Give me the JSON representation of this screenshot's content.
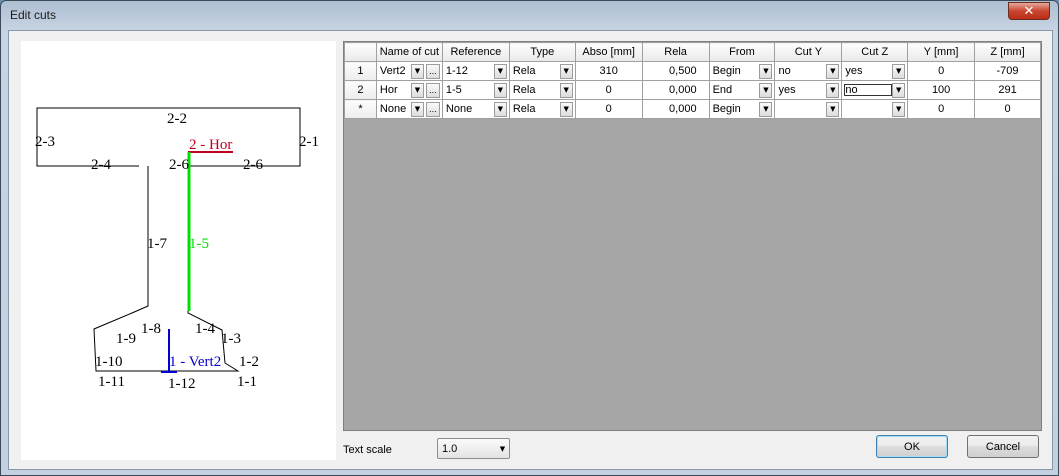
{
  "window": {
    "title": "Edit cuts",
    "close_glyph": "✕"
  },
  "drawing": {
    "labels": {
      "top_2_2": "2-2",
      "left_2_3": "2-3",
      "right_2_1": "2-1",
      "left_2_4": "2-4",
      "mid_2_6a": "2-6",
      "right_2_6": "2-6",
      "cut_hor": "2 - Hor",
      "web_1_7": "1-7",
      "web_1_5": "1-5",
      "b_1_8": "1-8",
      "b_1_9": "1-9",
      "b_1_4": "1-4",
      "b_1_3": "1-3",
      "b_1_10": "1-10",
      "b_1_2": "1-2",
      "cut_vert": "1 - Vert2",
      "b_1_11": "1-11",
      "b_1_12": "1-12",
      "b_1_1": "1-1"
    },
    "colors": {
      "outline": "#000000",
      "hor_cut": "#c00020",
      "web_highlight": "#00e000",
      "vert_cut": "#0000d0"
    }
  },
  "grid": {
    "columns": [
      "",
      "Name of cut",
      "Reference",
      "Type",
      "Abso [mm]",
      "Rela",
      "From",
      "Cut Y",
      "Cut Z",
      "Y  [mm]",
      "Z  [mm]"
    ],
    "rows": [
      {
        "id": "1",
        "name": "Vert2",
        "reference": "1-12",
        "type": "Rela",
        "abso": "310",
        "rela": "0,500",
        "from": "Begin",
        "cut_y": "no",
        "cut_z": "yes",
        "y": "0",
        "z": "-709"
      },
      {
        "id": "2",
        "name": "Hor",
        "reference": "1-5",
        "type": "Rela",
        "abso": "0",
        "rela": "0,000",
        "from": "End",
        "cut_y": "yes",
        "cut_z": "no",
        "y": "100",
        "z": "291"
      },
      {
        "id": "*",
        "name": "None",
        "reference": "None",
        "type": "Rela",
        "abso": "0",
        "rela": "0,000",
        "from": "Begin",
        "cut_y": "",
        "cut_z": "",
        "y": "0",
        "z": "0"
      }
    ],
    "ellipsis": "..."
  },
  "footer": {
    "text_scale_label": "Text scale",
    "text_scale_value": "1.0",
    "ok_label": "OK",
    "cancel_label": "Cancel"
  },
  "icons": {
    "dropdown": "chevron-down-icon",
    "close": "close-icon"
  }
}
